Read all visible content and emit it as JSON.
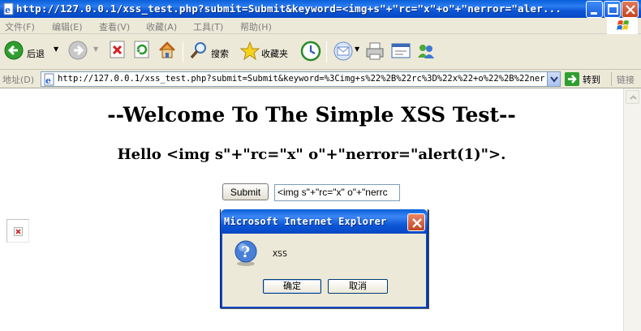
{
  "window": {
    "title": "http://127.0.0.1/xss_test.php?submit=Submit&keyword=<img+s\"+\"rc=\"x\"+o\"+\"nerror=\"aler..."
  },
  "menu": {
    "items": [
      "文件(F)",
      "编辑(E)",
      "查看(V)",
      "收藏(A)",
      "工具(T)",
      "帮助(H)"
    ]
  },
  "toolbar": {
    "back_label": "后退",
    "search_label": "搜索",
    "favorites_label": "收藏夹"
  },
  "address": {
    "label": "地址(D)",
    "url": "http://127.0.0.1/xss_test.php?submit=Submit&keyword=%3Cimg+s%22%2B%22rc%3D%22x%22+o%22%2B%22nerror%3",
    "go_label": "转到",
    "links_label": "链接"
  },
  "page": {
    "heading": "--Welcome To The Simple XSS Test--",
    "hello": "Hello <img s\"+\"rc=\"x\" o\"+\"nerror=\"alert(1)\">.",
    "submit_label": "Submit",
    "keyword_value": "<img s\"+\"rc=\"x\" o\"+\"nerrc"
  },
  "dialog": {
    "title": "Microsoft Internet Explorer",
    "message": "XSS",
    "ok_label": "确定",
    "cancel_label": "取消"
  },
  "colors": {
    "xp_blue": "#0548c4",
    "toolbar_bg": "#ece9d8",
    "close_red": "#c4451f"
  }
}
